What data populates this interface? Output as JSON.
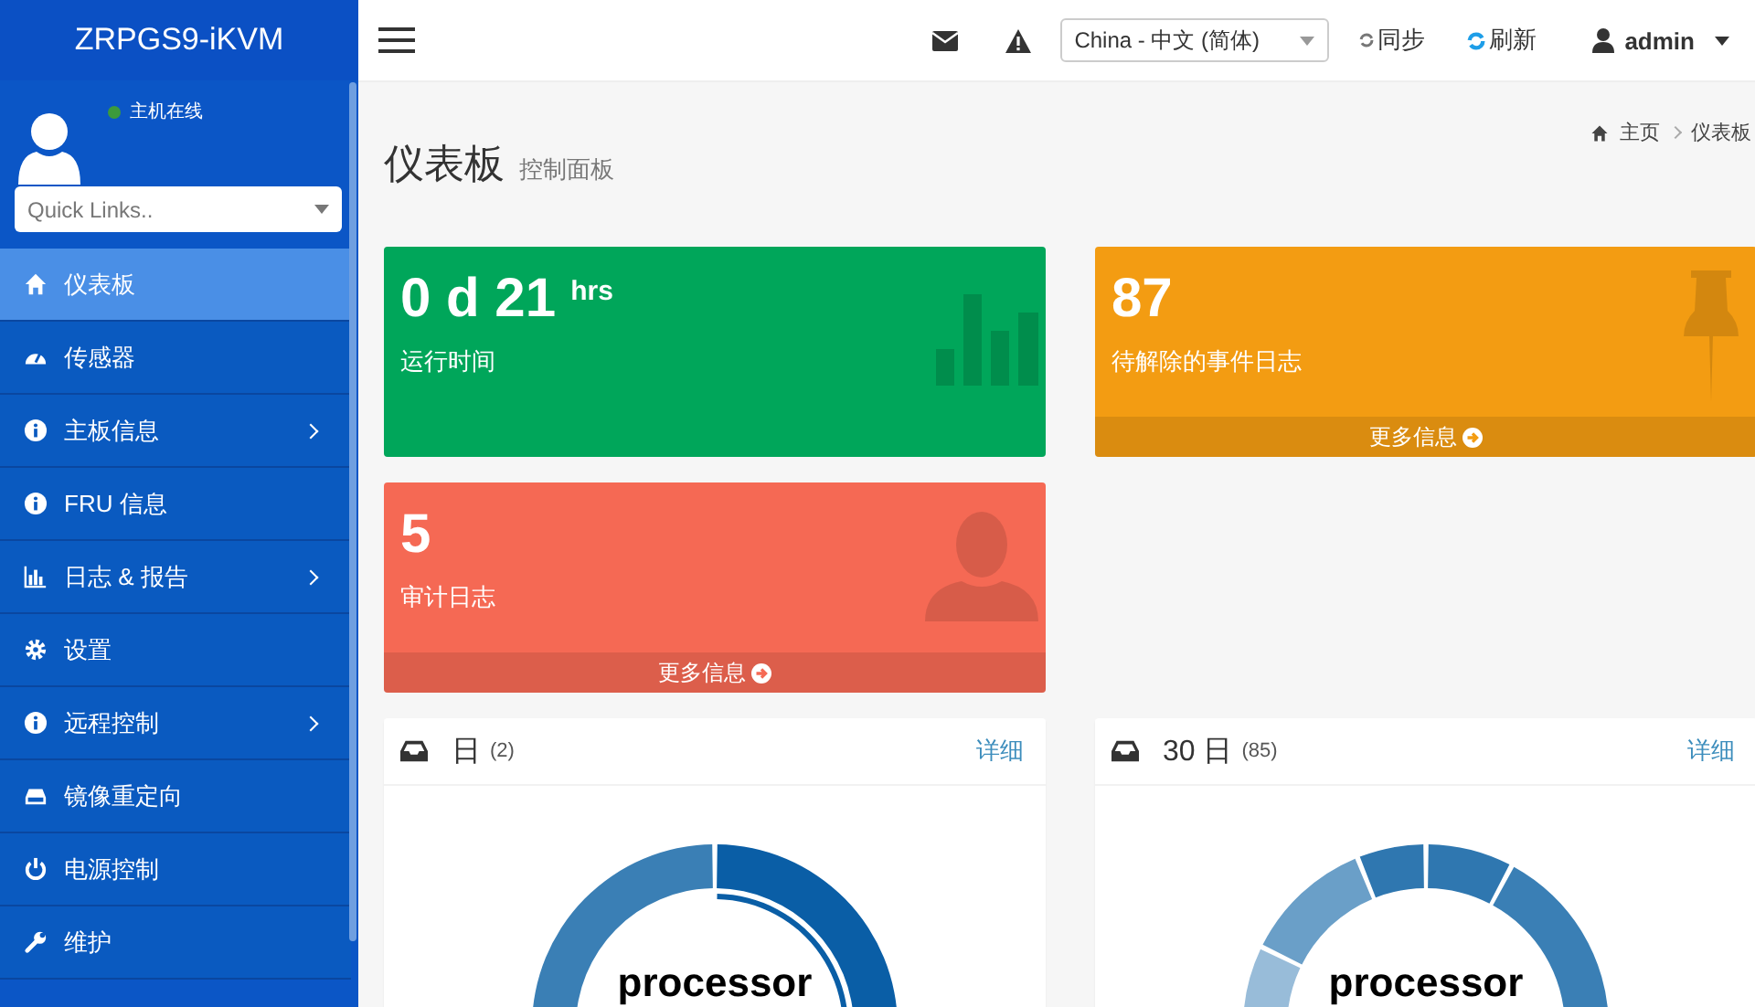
{
  "sidebar": {
    "brand": "ZRPGS9-iKVM",
    "user_status": {
      "label": "主机在线",
      "color": "#3c9a3c"
    },
    "quick_links": {
      "placeholder": "Quick Links.."
    },
    "items": [
      {
        "label": "仪表板",
        "kind": "home",
        "selected": true,
        "has_submenu": false
      },
      {
        "label": "传感器",
        "kind": "gauge",
        "selected": false,
        "has_submenu": false
      },
      {
        "label": "主板信息",
        "kind": "info",
        "selected": false,
        "has_submenu": true
      },
      {
        "label": "FRU 信息",
        "kind": "info",
        "selected": false,
        "has_submenu": false
      },
      {
        "label": "日志 & 报告",
        "kind": "bars",
        "selected": false,
        "has_submenu": true
      },
      {
        "label": "设置",
        "kind": "gear",
        "selected": false,
        "has_submenu": false
      },
      {
        "label": "远程控制",
        "kind": "info",
        "selected": false,
        "has_submenu": true
      },
      {
        "label": "镜像重定向",
        "kind": "drive",
        "selected": false,
        "has_submenu": false
      },
      {
        "label": "电源控制",
        "kind": "power",
        "selected": false,
        "has_submenu": false
      },
      {
        "label": "维护",
        "kind": "wrench",
        "selected": false,
        "has_submenu": false
      }
    ]
  },
  "topbar": {
    "language": "China - 中文 (简体)",
    "sync": "同步",
    "refresh": "刷新",
    "user": "admin"
  },
  "page": {
    "title": "仪表板",
    "subtitle": "控制面板",
    "breadcrumb": [
      "主页",
      "仪表板"
    ]
  },
  "info_boxes": [
    {
      "kind": "bars",
      "color": "#00a65a",
      "value": "0 d 21",
      "unit": "hrs",
      "label": "运行时间"
    },
    {
      "kind": "pin",
      "color": "#f39c12",
      "value": "87",
      "label": "待解除的事件日志",
      "more": "更多信息"
    },
    {
      "kind": "user",
      "color": "#f56954",
      "value": "5",
      "label": "审计日志",
      "more": "更多信息"
    }
  ],
  "panels": [
    {
      "title": "日",
      "count": "(2)",
      "link": "详细",
      "center_label": "processor",
      "kind": "two"
    },
    {
      "title": "30 日",
      "count": "(85)",
      "link": "详细",
      "center_label": "processor",
      "kind": "many"
    }
  ]
}
